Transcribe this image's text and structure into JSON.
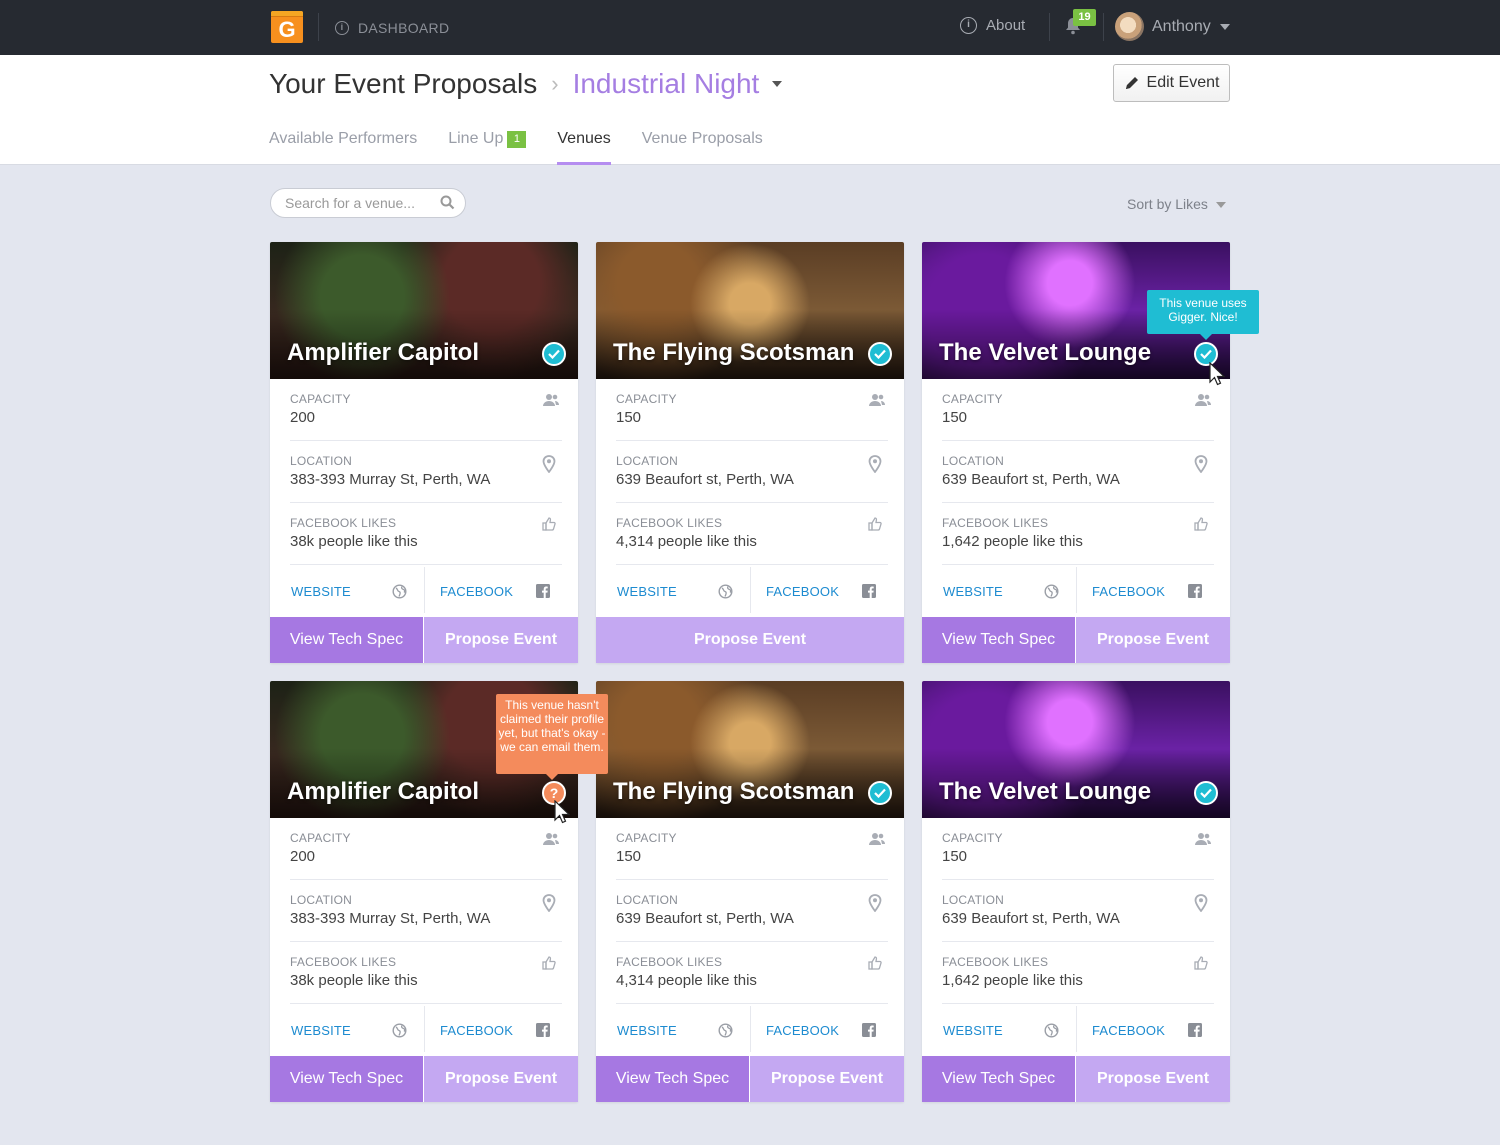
{
  "nav": {
    "dashboard_label": "DASHBOARD",
    "about_label": "About",
    "notification_count": "19",
    "user_name": "Anthony"
  },
  "header": {
    "breadcrumb_parent": "Your Event Proposals",
    "event_name": "Industrial Night",
    "edit_button": "Edit Event"
  },
  "tabs": [
    {
      "label": "Available Performers"
    },
    {
      "label": "Line Up",
      "badge": "1"
    },
    {
      "label": "Venues"
    },
    {
      "label": "Venue Proposals"
    }
  ],
  "toolbar": {
    "search_placeholder": "Search for a venue...",
    "sort_label": "Sort by Likes"
  },
  "labels": {
    "capacity": "CAPACITY",
    "location": "LOCATION",
    "facebook_likes": "FACEBOOK LIKES",
    "website": "WEBSITE",
    "facebook": "FACEBOOK",
    "view_tech_spec": "View Tech Spec",
    "propose_event": "Propose Event"
  },
  "tooltips": {
    "verified": "This venue uses Gigger. Nice!",
    "unclaimed": "This venue hasn't claimed their profile yet, but that's okay - we can email them."
  },
  "venues": [
    {
      "name": "Amplifier Capitol",
      "capacity": "200",
      "location": "383-393 Murray St, Perth, WA",
      "likes": "38k people like this",
      "status": "verified",
      "tech_spec": true
    },
    {
      "name": "The Flying Scotsman",
      "capacity": "150",
      "location": "639 Beaufort st, Perth, WA",
      "likes": "4,314 people like this",
      "status": "verified",
      "tech_spec": false
    },
    {
      "name": "The Velvet Lounge",
      "capacity": "150",
      "location": "639 Beaufort st, Perth, WA",
      "likes": "1,642 people like this",
      "status": "verified",
      "tech_spec": true
    },
    {
      "name": "Amplifier Capitol",
      "capacity": "200",
      "location": "383-393 Murray St, Perth, WA",
      "likes": "38k people like this",
      "status": "unclaimed",
      "tech_spec": true
    },
    {
      "name": "The Flying Scotsman",
      "capacity": "150",
      "location": "639 Beaufort st, Perth, WA",
      "likes": "4,314 people like this",
      "status": "verified",
      "tech_spec": true
    },
    {
      "name": "The Velvet Lounge",
      "capacity": "150",
      "location": "639 Beaufort st, Perth, WA",
      "likes": "1,642 people like this",
      "status": "verified",
      "tech_spec": true
    }
  ],
  "colors": {
    "topbar": "#262a31",
    "accent_purple": "#a678e2",
    "propose_purple": "#c4a8f2",
    "verified_teal": "#1fbdd3",
    "unclaimed_orange": "#f48b5c",
    "badge_green": "#7ac143"
  }
}
